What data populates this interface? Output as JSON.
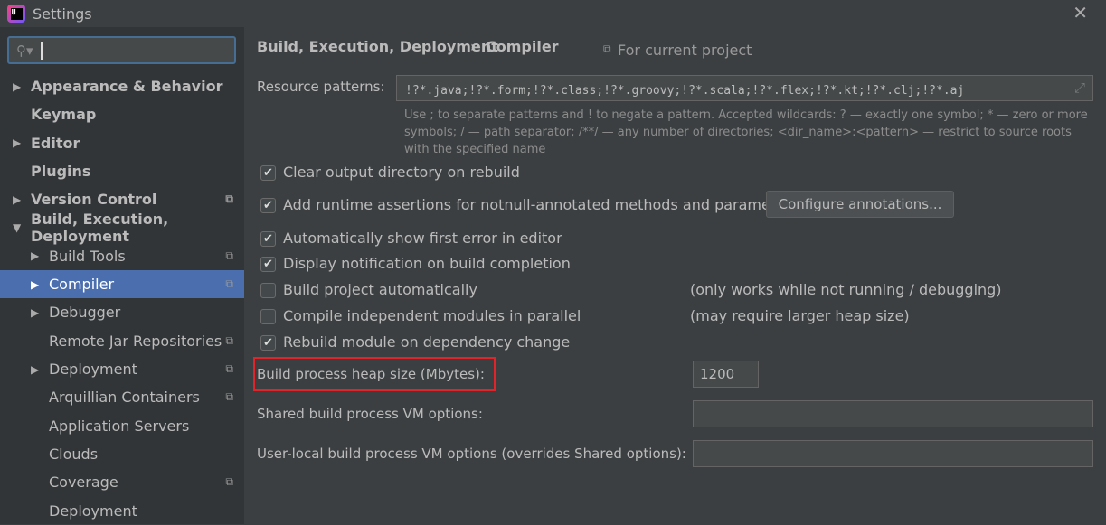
{
  "window": {
    "title": "Settings",
    "close_icon": "close-icon"
  },
  "search": {
    "value": "",
    "icon": "search-icon"
  },
  "sidebar": {
    "items": [
      {
        "label": "Appearance & Behavior",
        "bold": true,
        "arrow": "right",
        "indent": 0,
        "project": false
      },
      {
        "label": "Keymap",
        "bold": true,
        "arrow": "",
        "indent": 0,
        "project": false
      },
      {
        "label": "Editor",
        "bold": true,
        "arrow": "right",
        "indent": 0,
        "project": false
      },
      {
        "label": "Plugins",
        "bold": true,
        "arrow": "",
        "indent": 0,
        "project": false
      },
      {
        "label": "Version Control",
        "bold": true,
        "arrow": "right",
        "indent": 0,
        "project": true
      },
      {
        "label": "Build, Execution, Deployment",
        "bold": true,
        "arrow": "down",
        "indent": 0,
        "project": false
      },
      {
        "label": "Build Tools",
        "bold": false,
        "arrow": "right",
        "indent": 1,
        "project": true
      },
      {
        "label": "Compiler",
        "bold": false,
        "arrow": "right",
        "indent": 1,
        "project": true,
        "selected": true
      },
      {
        "label": "Debugger",
        "bold": false,
        "arrow": "right",
        "indent": 1,
        "project": false
      },
      {
        "label": "Remote Jar Repositories",
        "bold": false,
        "arrow": "",
        "indent": 1,
        "project": true
      },
      {
        "label": "Deployment",
        "bold": false,
        "arrow": "right",
        "indent": 1,
        "project": true
      },
      {
        "label": "Arquillian Containers",
        "bold": false,
        "arrow": "",
        "indent": 1,
        "project": true
      },
      {
        "label": "Application Servers",
        "bold": false,
        "arrow": "",
        "indent": 1,
        "project": false
      },
      {
        "label": "Clouds",
        "bold": false,
        "arrow": "",
        "indent": 1,
        "project": false
      },
      {
        "label": "Coverage",
        "bold": false,
        "arrow": "",
        "indent": 1,
        "project": true
      },
      {
        "label": "Deployment",
        "bold": false,
        "arrow": "",
        "indent": 1,
        "project": false
      }
    ]
  },
  "breadcrumb": {
    "parent": "Build, Execution, Deployment",
    "separator": "›",
    "current": "Compiler",
    "scope": "For current project"
  },
  "resource": {
    "label": "Resource patterns:",
    "value": "!?*.java;!?*.form;!?*.class;!?*.groovy;!?*.scala;!?*.flex;!?*.kt;!?*.clj;!?*.aj",
    "hint": "Use ; to separate patterns and ! to negate a pattern. Accepted wildcards: ? — exactly one symbol; * — zero or more symbols; / — path separator; /**/ — any number of directories; <dir_name>:<pattern> — restrict to source roots with the specified name"
  },
  "options": [
    {
      "label": "Clear output directory on rebuild",
      "checked": true,
      "note": ""
    },
    {
      "label": "Add runtime assertions for notnull-annotated methods and parameters",
      "checked": true,
      "note": ""
    },
    {
      "label": "Automatically show first error in editor",
      "checked": true,
      "note": ""
    },
    {
      "label": "Display notification on build completion",
      "checked": true,
      "note": ""
    },
    {
      "label": "Build project automatically",
      "checked": false,
      "note": "(only works while not running / debugging)"
    },
    {
      "label": "Compile independent modules in parallel",
      "checked": false,
      "note": "(may require larger heap size)"
    },
    {
      "label": "Rebuild module on dependency change",
      "checked": true,
      "note": ""
    }
  ],
  "configure_button": "Configure annotations...",
  "heap": {
    "label": "Build process heap size (Mbytes):",
    "value": "1200"
  },
  "shared_vm": {
    "label": "Shared build process VM options:",
    "value": ""
  },
  "user_vm": {
    "label": "User-local build process VM options (overrides Shared options):",
    "value": ""
  },
  "highlight_color": "#e0242a"
}
